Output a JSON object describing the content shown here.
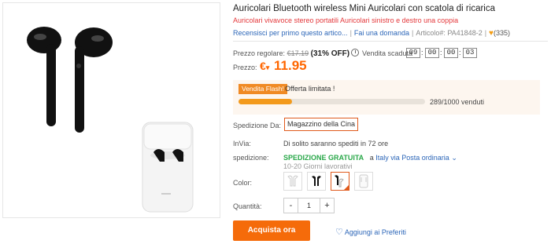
{
  "product": {
    "title": "Auricolari Bluetooth wireless Mini Auricolari con scatola di ricarica",
    "subtitle": "Auricolari vivavoce stereo portatili Auricolari sinistro e destro una coppia"
  },
  "links": {
    "reviews": "Recensisci per primo questo artico...",
    "question": "Fai una domanda",
    "article": "Articolo#: PA41848-2",
    "likes": "(335)"
  },
  "pricing": {
    "regular_label": "Prezzo regolare:",
    "regular_price": "€17.19",
    "discount": "(31% OFF)",
    "timer_label": "Vendita scaduta",
    "timer": [
      "09",
      "00",
      "00",
      "03"
    ],
    "price_label": "Prezzo:",
    "currency": "€",
    "price": "11.95"
  },
  "flash": {
    "badge": "Vendita Flash!",
    "offer": "Offerta limitata !",
    "sold_text": "289/1000 venduti",
    "progress": 0.289
  },
  "shipping": {
    "from_label": "Spedizione Da:",
    "warehouse": "Magazzino della Cina",
    "invia_label": "InVia:",
    "invia_value": "Di solito saranno spediti in 72 ore",
    "ship_label": "spedizione:",
    "free": "SPEDIZIONE GRATUITA",
    "to": "a",
    "country": "Italy",
    "method": "via Posta ordinaria",
    "days": "10-20 Giorni lavorativi"
  },
  "options": {
    "color_label": "Color:",
    "qty_label": "Quantità:",
    "qty": "1",
    "minus": "-",
    "plus": "+"
  },
  "actions": {
    "buy": "Acquista ora",
    "wishlist": "Aggiungi ai Preferiti"
  },
  "colors": {
    "accent": "#ff6600",
    "buy": "#f56b0a",
    "link": "#2c66b8",
    "free_ship": "#2aa84a"
  }
}
